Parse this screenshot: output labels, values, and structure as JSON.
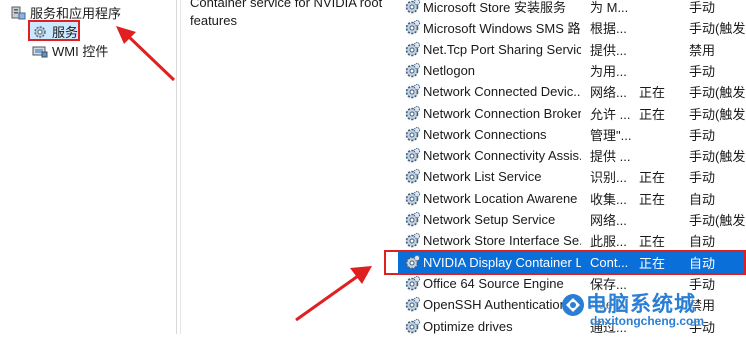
{
  "tree": {
    "parent_label": "服务和应用程序",
    "services_label": "服务",
    "wmi_label": "WMI 控件"
  },
  "description": {
    "text_line1": "Container service for NVIDIA root",
    "text_line2": "features"
  },
  "services": [
    {
      "name": "Microsoft Store 安装服务",
      "desc": "为 M...",
      "status": "",
      "start": "手动"
    },
    {
      "name": "Microsoft Windows SMS 路...",
      "desc": "根据...",
      "status": "",
      "start": "手动(触发"
    },
    {
      "name": "Net.Tcp Port Sharing Service",
      "desc": "提供...",
      "status": "",
      "start": "禁用"
    },
    {
      "name": "Netlogon",
      "desc": "为用...",
      "status": "",
      "start": "手动"
    },
    {
      "name": "Network Connected Devic...",
      "desc": "网络...",
      "status": "正在",
      "start": "手动(触发"
    },
    {
      "name": "Network Connection Broker",
      "desc": "允许 ...",
      "status": "正在",
      "start": "手动(触发"
    },
    {
      "name": "Network Connections",
      "desc": "管理\"...",
      "status": "",
      "start": "手动"
    },
    {
      "name": "Network Connectivity Assis...",
      "desc": "提供 ...",
      "status": "",
      "start": "手动(触发"
    },
    {
      "name": "Network List Service",
      "desc": "识别...",
      "status": "正在",
      "start": "手动"
    },
    {
      "name": "Network Location Awarene",
      "desc": "收集...",
      "status": "正在",
      "start": "自动"
    },
    {
      "name": "Network Setup Service",
      "desc": "网络...",
      "status": "",
      "start": "手动(触发"
    },
    {
      "name": "Network Store Interface Se...",
      "desc": "此服...",
      "status": "正在",
      "start": "自动"
    },
    {
      "name": "NVIDIA Display Container LS",
      "desc": "Cont...",
      "status": "正在",
      "start": "自动",
      "selected": true
    },
    {
      "name": "Office 64 Source Engine",
      "desc": "保存...",
      "status": "",
      "start": "手动"
    },
    {
      "name": "OpenSSH Authentication ...",
      "desc": "Age...",
      "status": "",
      "start": "禁用"
    },
    {
      "name": "Optimize drives",
      "desc": "通过...",
      "status": "",
      "start": "手动"
    }
  ],
  "watermark": {
    "title": "电脑系统城",
    "url": "dnxitongcheng.com"
  },
  "colors": {
    "selection": "#0a6fd8",
    "annotation_red": "#e02020",
    "tree_selection": "#cce8ff",
    "watermark_blue": "#2a7fd4"
  }
}
